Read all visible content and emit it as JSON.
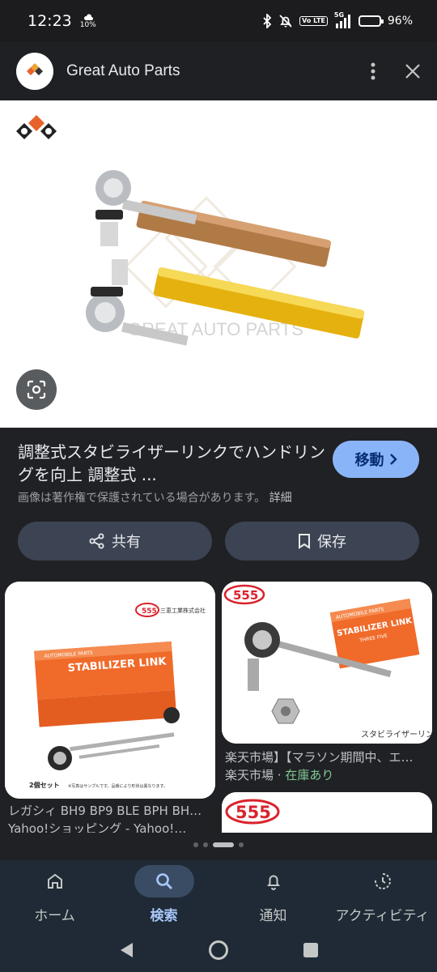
{
  "status_bar": {
    "time": "12:23",
    "weather_pct": "10%",
    "volte_label": "Vo LTE",
    "network": "5G",
    "battery_pct": "96%",
    "battery_level": 0.96
  },
  "header": {
    "site_name": "Great Auto Parts"
  },
  "main_image": {
    "watermark_text": "GREAT AUTO PARTS"
  },
  "result": {
    "title": "調整式スタビライザーリンクでハンドリングを向上 調整式 ...",
    "visit_label": "移動",
    "copyright_notice": "画像は著作権で保護されている場合があります。",
    "details_link": "詳細"
  },
  "actions": {
    "share_label": "共有",
    "save_label": "保存"
  },
  "related": [
    {
      "box_brand": "STABILIZER LINK",
      "box_top": "AUTOMOBILE PARTS",
      "maker": "三恵工業株式会社",
      "set_text": "2個セット",
      "note_text": "※写真はサンプルです。品番により形状は異なります。",
      "caption_title": "レガシィ BH9 BP9 BLE BPH BH…",
      "caption_source": "Yahoo!ショッピング - Yahoo!…"
    },
    {
      "box_brand": "STABILIZER LINK",
      "box_top": "AUTOMOBILE PARTS",
      "box_sub": "THREE FIVE",
      "image_label": "スタビライザーリンク",
      "caption_title": "楽天市場】【マラソン期間中、エ…",
      "caption_source": "楽天市場",
      "caption_sep": " · ",
      "caption_stock": "在庫あり"
    },
    {
      "brand_mark": "555"
    }
  ],
  "pager": {
    "total": 4,
    "active": 2
  },
  "bottom_nav": [
    {
      "label": "ホーム",
      "icon": "home-icon"
    },
    {
      "label": "検索",
      "icon": "search-icon",
      "active": true
    },
    {
      "label": "通知",
      "icon": "bell-icon"
    },
    {
      "label": "アクティビティ",
      "icon": "activity-icon"
    }
  ],
  "colors": {
    "accent": "#8ab4f8",
    "background": "#202124",
    "nav_background": "#1f2a36",
    "in_stock": "#81c995",
    "box_orange": "#f06a2a",
    "brand_red": "#d9232d"
  }
}
